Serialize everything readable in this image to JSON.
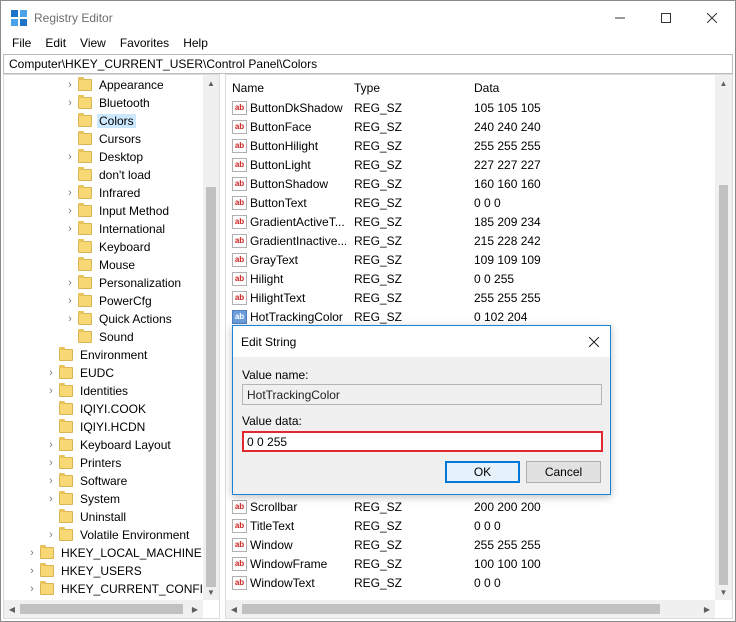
{
  "window": {
    "title": "Registry Editor"
  },
  "menu": [
    "File",
    "Edit",
    "View",
    "Favorites",
    "Help"
  ],
  "address": "Computer\\HKEY_CURRENT_USER\\Control Panel\\Colors",
  "tree": [
    {
      "label": "Appearance",
      "level": 2,
      "expandable": true,
      "selected": false
    },
    {
      "label": "Bluetooth",
      "level": 2,
      "expandable": true,
      "selected": false
    },
    {
      "label": "Colors",
      "level": 2,
      "expandable": false,
      "selected": true
    },
    {
      "label": "Cursors",
      "level": 2,
      "expandable": false,
      "selected": false
    },
    {
      "label": "Desktop",
      "level": 2,
      "expandable": true,
      "selected": false
    },
    {
      "label": "don't load",
      "level": 2,
      "expandable": false,
      "selected": false
    },
    {
      "label": "Infrared",
      "level": 2,
      "expandable": true,
      "selected": false
    },
    {
      "label": "Input Method",
      "level": 2,
      "expandable": true,
      "selected": false
    },
    {
      "label": "International",
      "level": 2,
      "expandable": true,
      "selected": false
    },
    {
      "label": "Keyboard",
      "level": 2,
      "expandable": false,
      "selected": false
    },
    {
      "label": "Mouse",
      "level": 2,
      "expandable": false,
      "selected": false
    },
    {
      "label": "Personalization",
      "level": 2,
      "expandable": true,
      "selected": false
    },
    {
      "label": "PowerCfg",
      "level": 2,
      "expandable": true,
      "selected": false
    },
    {
      "label": "Quick Actions",
      "level": 2,
      "expandable": true,
      "selected": false
    },
    {
      "label": "Sound",
      "level": 2,
      "expandable": false,
      "selected": false
    },
    {
      "label": "Environment",
      "level": 1,
      "expandable": false,
      "selected": false
    },
    {
      "label": "EUDC",
      "level": 1,
      "expandable": true,
      "selected": false
    },
    {
      "label": "Identities",
      "level": 1,
      "expandable": true,
      "selected": false
    },
    {
      "label": "IQIYI.COOK",
      "level": 1,
      "expandable": false,
      "selected": false
    },
    {
      "label": "IQIYI.HCDN",
      "level": 1,
      "expandable": false,
      "selected": false
    },
    {
      "label": "Keyboard Layout",
      "level": 1,
      "expandable": true,
      "selected": false
    },
    {
      "label": "Printers",
      "level": 1,
      "expandable": true,
      "selected": false
    },
    {
      "label": "Software",
      "level": 1,
      "expandable": true,
      "selected": false
    },
    {
      "label": "System",
      "level": 1,
      "expandable": true,
      "selected": false
    },
    {
      "label": "Uninstall",
      "level": 1,
      "expandable": false,
      "selected": false
    },
    {
      "label": "Volatile Environment",
      "level": 1,
      "expandable": true,
      "selected": false
    },
    {
      "label": "HKEY_LOCAL_MACHINE",
      "level": 0,
      "expandable": true,
      "selected": false
    },
    {
      "label": "HKEY_USERS",
      "level": 0,
      "expandable": true,
      "selected": false
    },
    {
      "label": "HKEY_CURRENT_CONFIG",
      "level": 0,
      "expandable": true,
      "selected": false
    }
  ],
  "columns": {
    "name": "Name",
    "type": "Type",
    "data": "Data"
  },
  "values_top": [
    {
      "name": "ButtonDkShadow",
      "type": "REG_SZ",
      "data": "105 105 105",
      "selected": false
    },
    {
      "name": "ButtonFace",
      "type": "REG_SZ",
      "data": "240 240 240",
      "selected": false
    },
    {
      "name": "ButtonHilight",
      "type": "REG_SZ",
      "data": "255 255 255",
      "selected": false
    },
    {
      "name": "ButtonLight",
      "type": "REG_SZ",
      "data": "227 227 227",
      "selected": false
    },
    {
      "name": "ButtonShadow",
      "type": "REG_SZ",
      "data": "160 160 160",
      "selected": false
    },
    {
      "name": "ButtonText",
      "type": "REG_SZ",
      "data": "0 0 0",
      "selected": false
    },
    {
      "name": "GradientActiveT...",
      "type": "REG_SZ",
      "data": "185 209 234",
      "selected": false
    },
    {
      "name": "GradientInactive...",
      "type": "REG_SZ",
      "data": "215 228 242",
      "selected": false
    },
    {
      "name": "GrayText",
      "type": "REG_SZ",
      "data": "109 109 109",
      "selected": false
    },
    {
      "name": "Hilight",
      "type": "REG_SZ",
      "data": "0 0 255",
      "selected": false
    },
    {
      "name": "HilightText",
      "type": "REG_SZ",
      "data": "255 255 255",
      "selected": false
    },
    {
      "name": "HotTrackingColor",
      "type": "REG_SZ",
      "data": "0 102 204",
      "selected": true
    }
  ],
  "values_bottom": [
    {
      "name": "Scrollbar",
      "type": "REG_SZ",
      "data": "200 200 200",
      "selected": false
    },
    {
      "name": "TitleText",
      "type": "REG_SZ",
      "data": "0 0 0",
      "selected": false
    },
    {
      "name": "Window",
      "type": "REG_SZ",
      "data": "255 255 255",
      "selected": false
    },
    {
      "name": "WindowFrame",
      "type": "REG_SZ",
      "data": "100 100 100",
      "selected": false
    },
    {
      "name": "WindowText",
      "type": "REG_SZ",
      "data": "0 0 0",
      "selected": false
    }
  ],
  "value_icon": "ab",
  "dialog": {
    "title": "Edit String",
    "value_name_label": "Value name:",
    "value_name": "HotTrackingColor",
    "value_data_label": "Value data:",
    "value_data": "0 0 255",
    "ok_label": "OK",
    "cancel_label": "Cancel"
  },
  "colors": {
    "accent": "#0078d7",
    "highlight_outline": "#e0292e",
    "selection": "#cce8ff"
  }
}
